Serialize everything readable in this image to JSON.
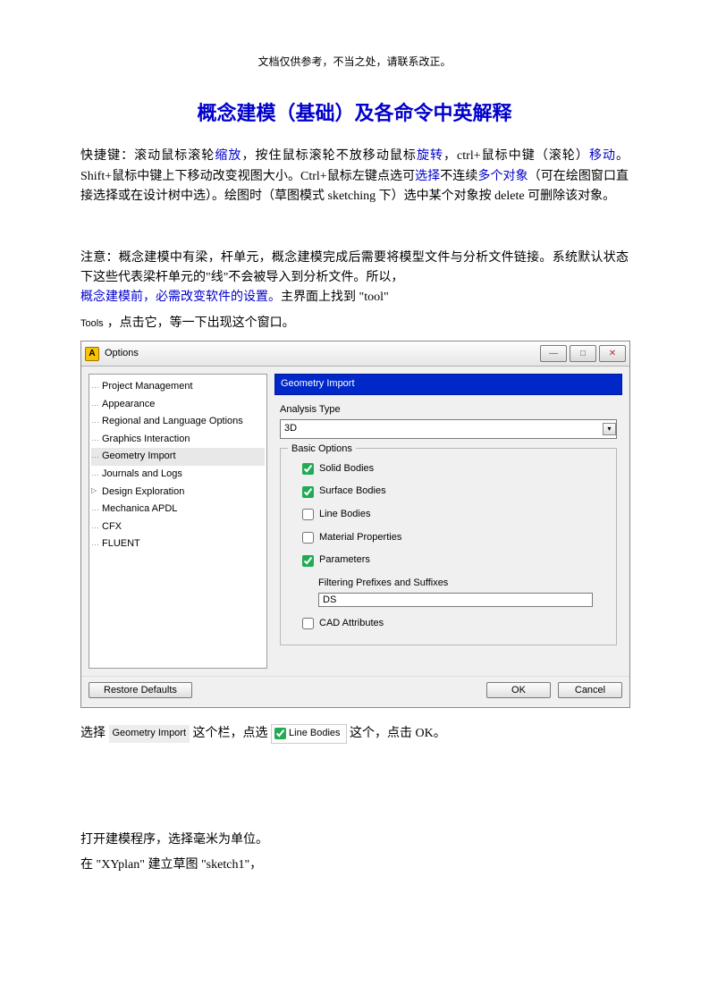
{
  "header_note": "文档仅供参考，不当之处，请联系改正。",
  "title": "概念建模（基础）及各命令中英解释",
  "para1": {
    "t1": "快捷键：滚动鼠标滚轮",
    "b1": "缩放",
    "t2": "，按住鼠标滚轮不放移动鼠标",
    "b2": "旋转",
    "t3": "，ctrl+鼠标中键（滚轮）",
    "b3": "移动",
    "t4": "。Shift+鼠标中键上下移动改变视图大小。Ctrl+鼠标左键点选可",
    "b4": "选择",
    "t5": "不连续",
    "b5": "多个对象",
    "t6": "（可在绘图窗口直接选择或在设计树中选）。绘图时（草图模式 sketching 下）选中某个对象按 delete 可删除该对象。"
  },
  "para2": {
    "t1": "注意：概念建模中有梁，杆单元，概念建模完成后需要将模型文件与分析文件链接。系统默认状态下这些代表梁杆单元的\"线\"不会被导入到分析文件。所以，",
    "b1": "概念建模前，必需改变软件的设置。",
    "t2": "主界面上找到 \"tool\""
  },
  "tools_line": {
    "label": "Tools",
    "rest": "，点击它，等一下出现这个窗口。"
  },
  "dialog": {
    "title": "Options",
    "icon_glyph": "A",
    "winbtns": {
      "min": "—",
      "max": "□",
      "close": "✕"
    },
    "tree_items": [
      "Project Management",
      "Appearance",
      "Regional and Language Options",
      "Graphics Interaction",
      "Geometry Import",
      "Journals and Logs",
      "Design Exploration",
      "Mechanica APDL",
      "CFX",
      "FLUENT"
    ],
    "tree_selected_index": 4,
    "tree_expander_index": 6,
    "pane_title": "Geometry Import",
    "analysis_label": "Analysis Type",
    "analysis_value": "3D",
    "basic_legend": "Basic Options",
    "checks": [
      {
        "label": "Solid Bodies",
        "checked": true
      },
      {
        "label": "Surface Bodies",
        "checked": true
      },
      {
        "label": "Line Bodies",
        "checked": false
      },
      {
        "label": "Material Properties",
        "checked": false
      },
      {
        "label": "Parameters",
        "checked": true
      }
    ],
    "filtering_label": "Filtering Prefixes and Suffixes",
    "filtering_value": "DS",
    "cad_attr": {
      "label": "CAD Attributes",
      "checked": false
    },
    "restore": "Restore Defaults",
    "ok": "OK",
    "cancel": "Cancel"
  },
  "select_line": {
    "t1": "选择 ",
    "label1": "Geometry Import",
    "t2": " 这个栏，点选 ",
    "cb_label": "Line Bodies",
    "t3": " 这个，点击 OK。"
  },
  "para3": "打开建模程序，选择毫米为单位。",
  "para4": "在 \"XYplan\" 建立草图 \"sketch1\"，"
}
